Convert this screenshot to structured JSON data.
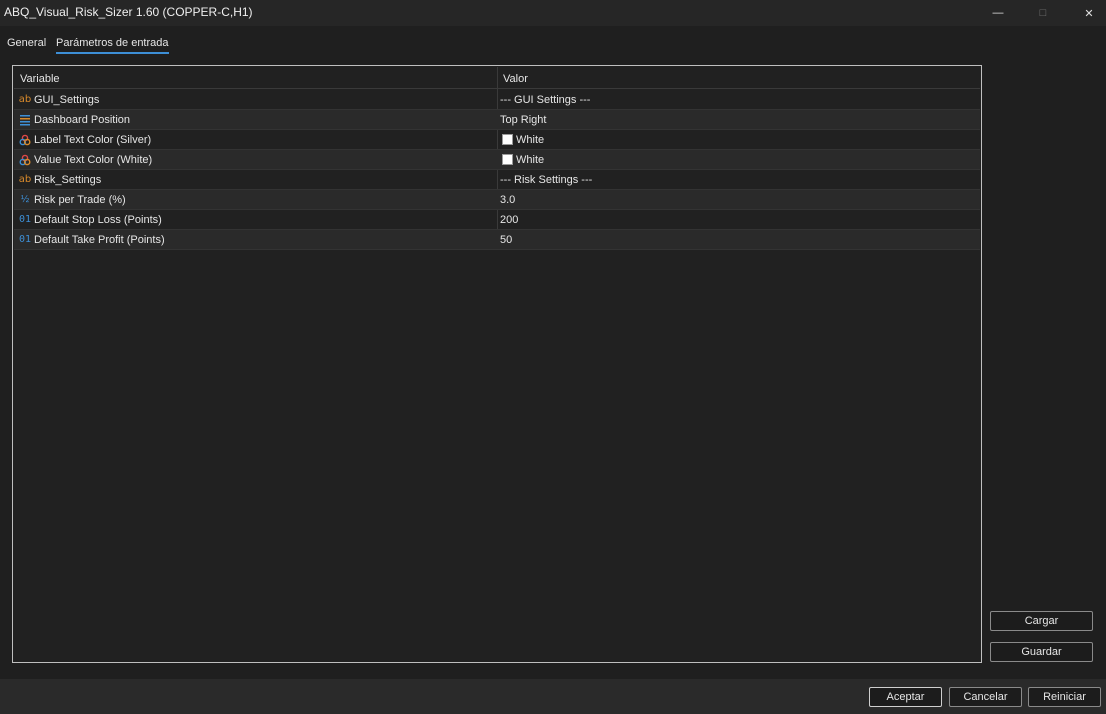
{
  "window": {
    "title": "ABQ_Visual_Risk_Sizer 1.60 (COPPER-C,H1)",
    "minimize_glyph": "—",
    "maximize_glyph": "□",
    "close_glyph": "✕"
  },
  "tabs": [
    {
      "label": "General",
      "active": false
    },
    {
      "label": "Parámetros de entrada",
      "active": true
    }
  ],
  "table": {
    "headers": {
      "variable": "Variable",
      "value": "Valor"
    },
    "rows": [
      {
        "icon": "string-icon",
        "icon_glyph": "ab",
        "name": "GUI_Settings",
        "value": "--- GUI Settings ---"
      },
      {
        "icon": "enum-icon",
        "icon_glyph": "",
        "name": "Dashboard Position",
        "value": "Top Right"
      },
      {
        "icon": "color-icon",
        "icon_glyph": "",
        "name": "Label Text Color (Silver)",
        "value": "White",
        "swatch": "#ffffff"
      },
      {
        "icon": "color-icon",
        "icon_glyph": "",
        "name": "Value Text Color (White)",
        "value": "White",
        "swatch": "#ffffff"
      },
      {
        "icon": "string-icon",
        "icon_glyph": "ab",
        "name": "Risk_Settings",
        "value": "--- Risk Settings ---"
      },
      {
        "icon": "double-icon",
        "icon_glyph": "½",
        "name": "Risk per Trade (%)",
        "value": "3.0"
      },
      {
        "icon": "integer-icon",
        "icon_glyph": "01",
        "name": "Default Stop Loss (Points)",
        "value": "200"
      },
      {
        "icon": "integer-icon",
        "icon_glyph": "01",
        "name": "Default Take Profit (Points)",
        "value": "50"
      }
    ]
  },
  "side_buttons": {
    "load": "Cargar",
    "save": "Guardar"
  },
  "footer_buttons": {
    "ok": "Aceptar",
    "cancel": "Cancelar",
    "reset": "Reiniciar"
  },
  "colors": {
    "accent": "#3d8fd6",
    "string_icon": "#d98a2b",
    "background": "#1f1f1f"
  }
}
